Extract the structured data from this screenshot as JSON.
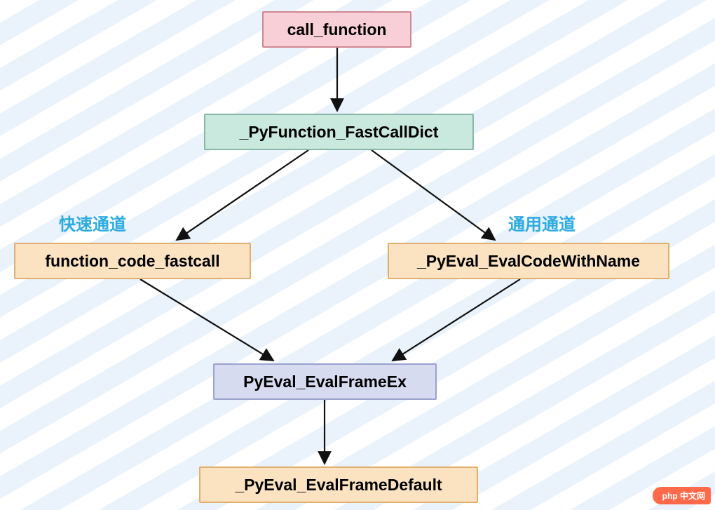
{
  "chart_data": {
    "type": "flowchart",
    "title": "",
    "nodes": [
      {
        "id": "n0",
        "label": "call_function",
        "fill": "#f8cfd6",
        "stroke": "#cf8793"
      },
      {
        "id": "n1",
        "label": "_PyFunction_FastCallDict",
        "fill": "#c9e9de",
        "stroke": "#88b7a5"
      },
      {
        "id": "n2",
        "label": "function_code_fastcall",
        "fill": "#fbe3c2",
        "stroke": "#e0ae6e"
      },
      {
        "id": "n3",
        "label": "_PyEval_EvalCodeWithName",
        "fill": "#fbe3c2",
        "stroke": "#e0ae6e"
      },
      {
        "id": "n4",
        "label": "PyEval_EvalFrameEx",
        "fill": "#d7dbf0",
        "stroke": "#9aa2cf"
      },
      {
        "id": "n5",
        "label": "_PyEval_EvalFrameDefault",
        "fill": "#fbe3c2",
        "stroke": "#e0ae6e"
      }
    ],
    "edges": [
      {
        "from": "n0",
        "to": "n1"
      },
      {
        "from": "n1",
        "to": "n2"
      },
      {
        "from": "n1",
        "to": "n3"
      },
      {
        "from": "n2",
        "to": "n4"
      },
      {
        "from": "n3",
        "to": "n4"
      },
      {
        "from": "n4",
        "to": "n5"
      }
    ],
    "labels": [
      {
        "id": "l0",
        "text": "快速通道",
        "color": "#2eabe1"
      },
      {
        "id": "l1",
        "text": "通用通道",
        "color": "#2eabe1"
      }
    ]
  },
  "watermark": "php 中文网"
}
